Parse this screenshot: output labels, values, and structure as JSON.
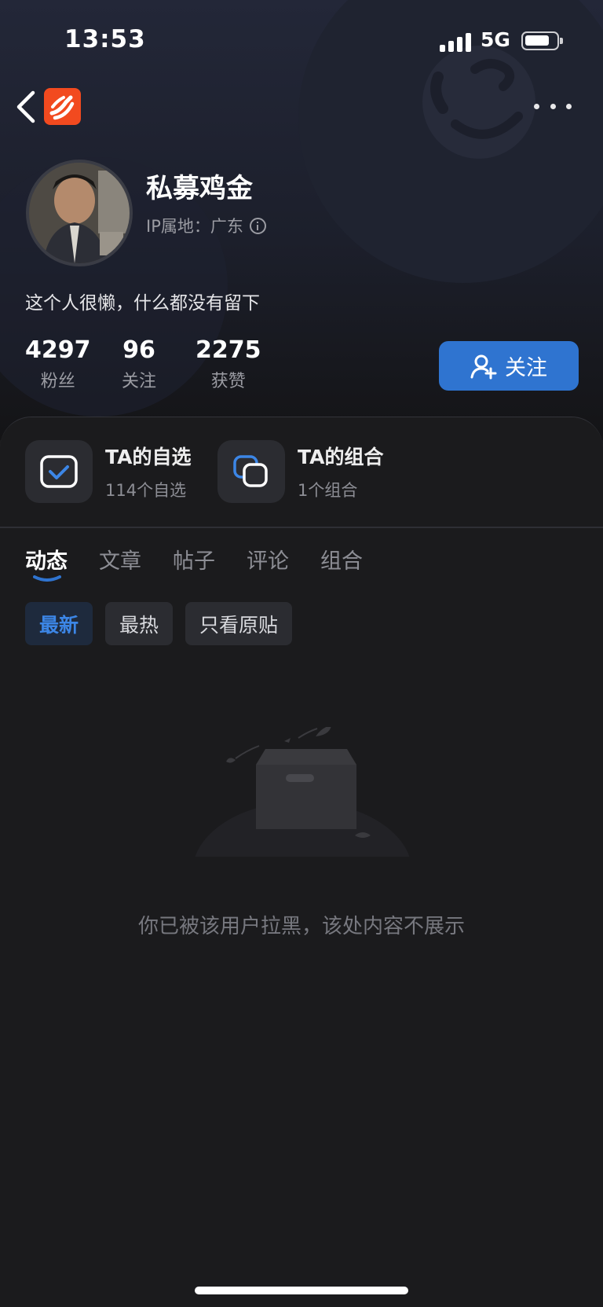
{
  "status_bar": {
    "time": "13:53",
    "network": "5G",
    "battery_level": 0.8
  },
  "nav": {
    "back_icon": "chevron-left-icon",
    "logo_icon": "app-logo-icon",
    "more_icon": "more-dots-icon"
  },
  "profile": {
    "username": "私募鸡金",
    "ip_label": "IP属地：广东",
    "bio": "这个人很懒，什么都没有留下",
    "stats": [
      {
        "value": "4297",
        "label": "粉丝"
      },
      {
        "value": "96",
        "label": "关注"
      },
      {
        "value": "2275",
        "label": "获赞"
      }
    ],
    "follow_label": "关注"
  },
  "cards": [
    {
      "title": "TA的自选",
      "subtitle": "114个自选",
      "icon": "watchlist-check-icon"
    },
    {
      "title": "TA的组合",
      "subtitle": "1个组合",
      "icon": "portfolio-squares-icon"
    }
  ],
  "tabs": [
    {
      "label": "动态",
      "active": true
    },
    {
      "label": "文章",
      "active": false
    },
    {
      "label": "帖子",
      "active": false
    },
    {
      "label": "评论",
      "active": false
    },
    {
      "label": "组合",
      "active": false
    }
  ],
  "filters": [
    {
      "label": "最新",
      "active": true
    },
    {
      "label": "最热",
      "active": false
    },
    {
      "label": "只看原贴",
      "active": false
    }
  ],
  "empty_message": "你已被该用户拉黑，该处内容不展示",
  "colors": {
    "accent": "#2f74d0",
    "background": "#1b1b1d",
    "logo": "#f24a1f"
  }
}
